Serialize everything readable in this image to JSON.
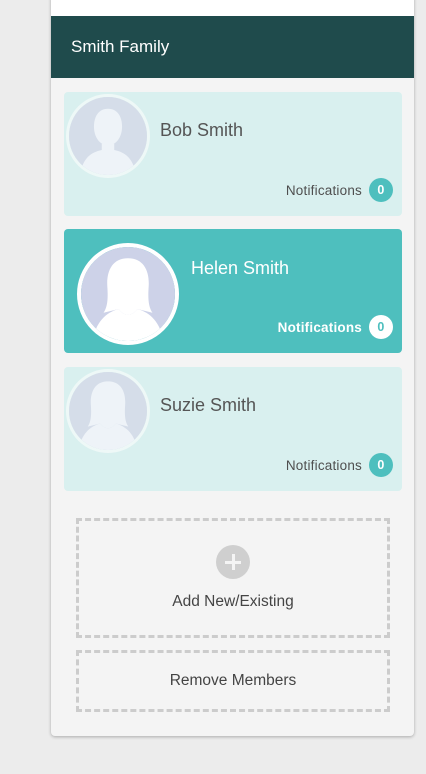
{
  "family": {
    "name": "Smith Family"
  },
  "members": [
    {
      "name": "Bob Smith",
      "notifications_label": "Notifications",
      "notifications_count": "0",
      "selected": false,
      "avatar_icon": "person-silhouette-icon"
    },
    {
      "name": "Helen Smith",
      "notifications_label": "Notifications",
      "notifications_count": "0",
      "selected": true,
      "avatar_icon": "person-silhouette-female-icon"
    },
    {
      "name": "Suzie Smith",
      "notifications_label": "Notifications",
      "notifications_count": "0",
      "selected": false,
      "avatar_icon": "person-silhouette-female-icon"
    }
  ],
  "actions": {
    "add_label": "Add New/Existing",
    "add_icon": "plus-circle-icon",
    "remove_label": "Remove Members"
  },
  "colors": {
    "header_bg": "#1f4b4c",
    "card_inactive_bg": "#d9f0ef",
    "card_active_bg": "#4ebfbe",
    "badge_teal": "#4ebfbe",
    "avatar_fill": "#d5dde9"
  }
}
